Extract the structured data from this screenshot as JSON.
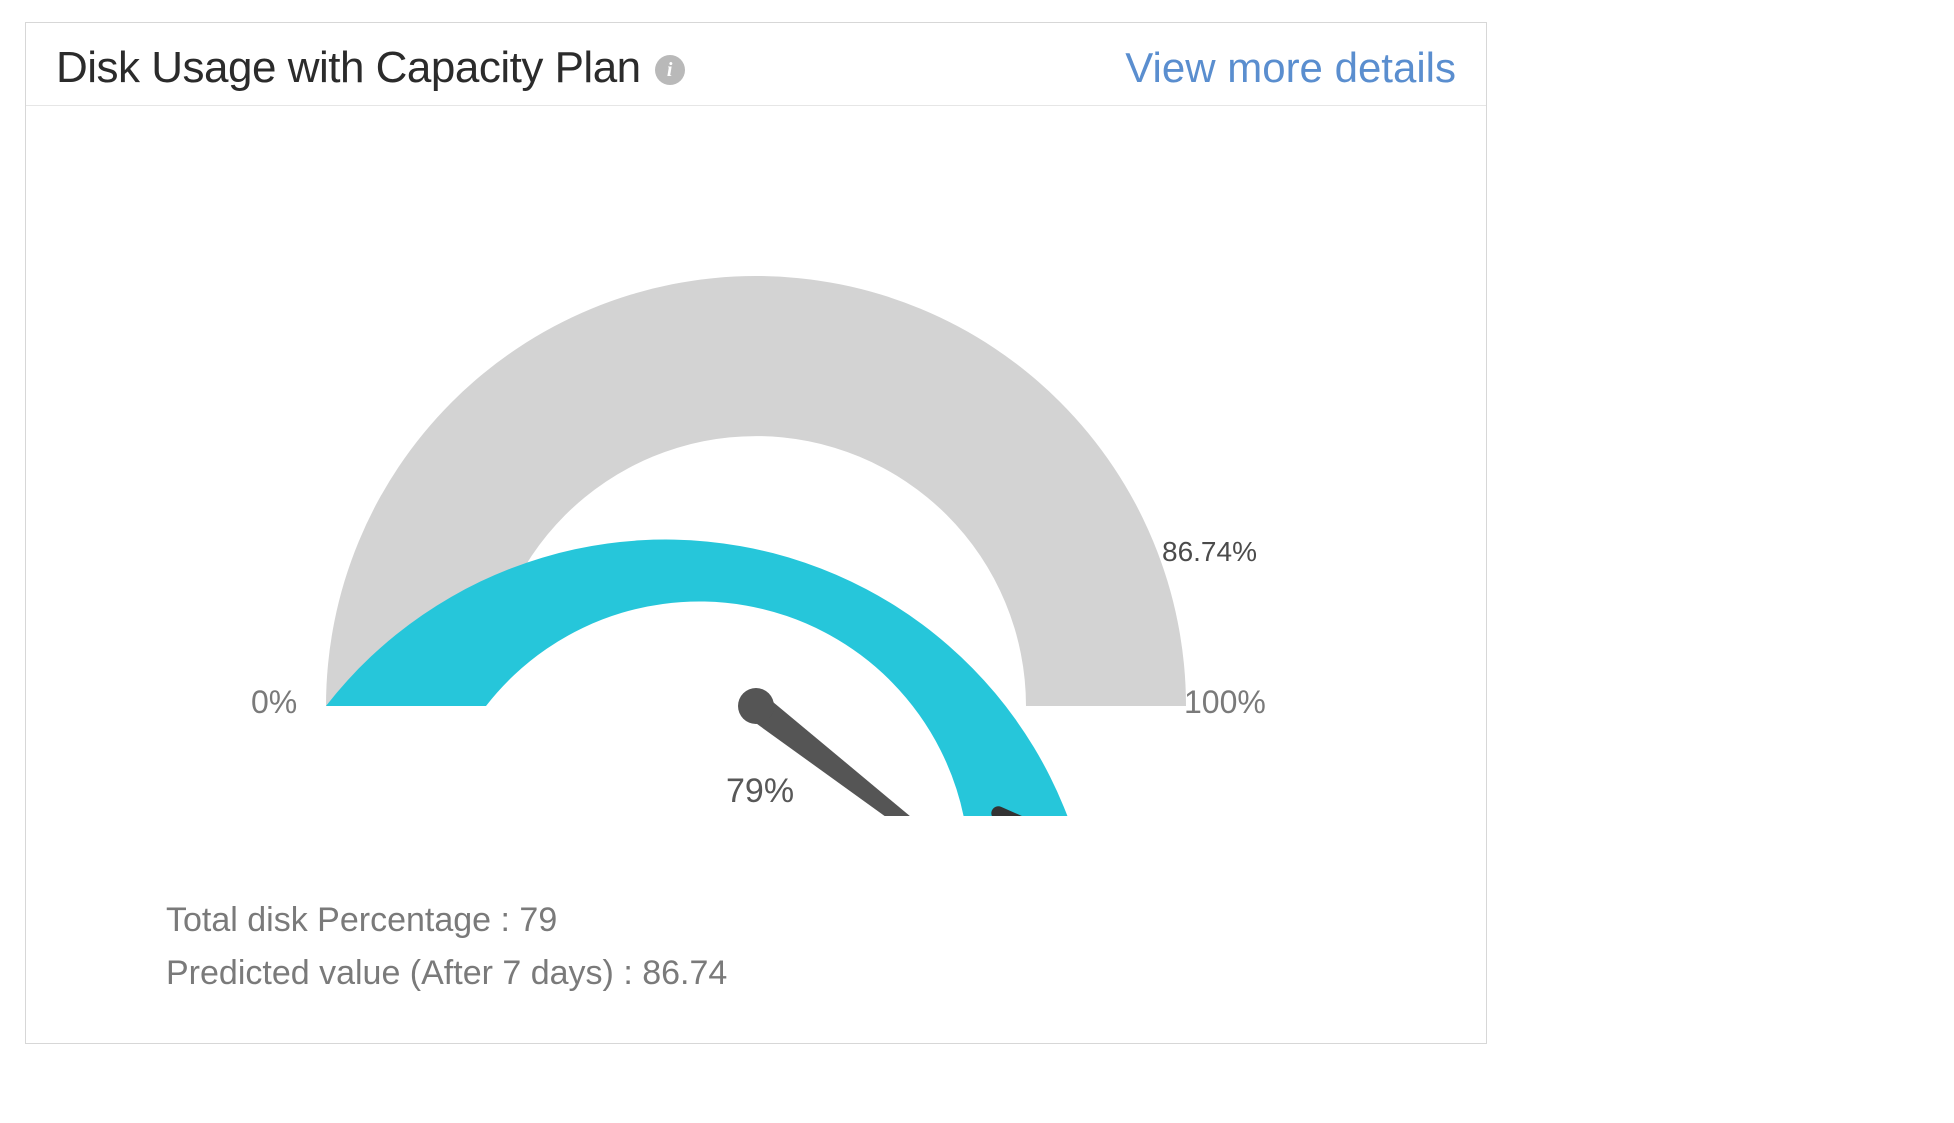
{
  "header": {
    "title": "Disk Usage with Capacity Plan",
    "info_glyph": "i",
    "details_link": "View more details"
  },
  "gauge": {
    "min_label": "0%",
    "max_label": "100%",
    "needle_label": "79%",
    "marker_label": "86.74%"
  },
  "stats": {
    "line1": "Total disk Percentage : 79",
    "line2": "Predicted value (After 7 days) : 86.74"
  },
  "colors": {
    "fill": "#26c6da",
    "track": "#d3d3d3",
    "needle": "#555555",
    "marker": "#333333"
  },
  "chart_data": {
    "type": "gauge",
    "title": "Disk Usage with Capacity Plan",
    "min": 0,
    "max": 100,
    "value": 79,
    "marker_value": 86.74,
    "unit": "%",
    "series": [
      {
        "name": "Total disk Percentage",
        "values": [
          79
        ]
      },
      {
        "name": "Predicted value (After 7 days)",
        "values": [
          86.74
        ]
      }
    ]
  }
}
